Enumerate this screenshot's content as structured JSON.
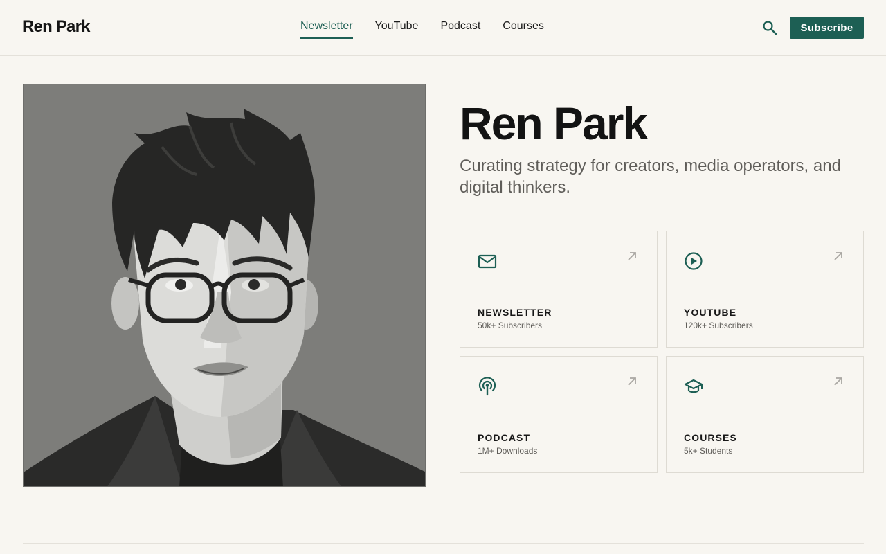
{
  "header": {
    "logo": "Ren Park",
    "nav": [
      "Newsletter",
      "YouTube",
      "Podcast",
      "Courses"
    ],
    "active_nav": "Newsletter",
    "subscribe_label": "Subscribe",
    "search_icon": "search-icon"
  },
  "hero": {
    "name": "Ren Park",
    "tagline": "Curating strategy for creators, media operators, and digital thinkers."
  },
  "cards": [
    {
      "title": "NEWSLETTER",
      "meta": "50k+ Subscribers",
      "icon": "mail-icon"
    },
    {
      "title": "YOUTUBE",
      "meta": "120k+ Subscribers",
      "icon": "play-circle-icon"
    },
    {
      "title": "PODCAST",
      "meta": "1M+ Downloads",
      "icon": "podcast-icon"
    },
    {
      "title": "COURSES",
      "meta": "5k+ Students",
      "icon": "graduation-cap-icon"
    }
  ],
  "colors": {
    "accent": "#1d5f54",
    "background": "#f8f6f1",
    "text": "#151515",
    "muted": "#5f5d59"
  }
}
